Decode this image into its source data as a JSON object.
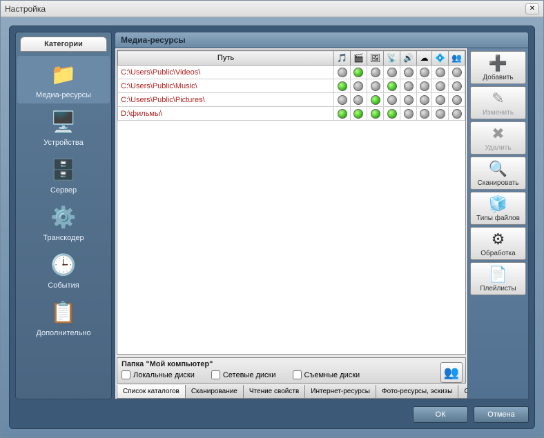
{
  "window": {
    "title": "Настройка"
  },
  "sidebar": {
    "header": "Категории",
    "items": [
      {
        "label": "Медиа-ресурсы",
        "icon": "📁"
      },
      {
        "label": "Устройства",
        "icon": "🖥️"
      },
      {
        "label": "Сервер",
        "icon": "🗄️"
      },
      {
        "label": "Транскодер",
        "icon": "⚙️"
      },
      {
        "label": "События",
        "icon": "🕒"
      },
      {
        "label": "Дополнительно",
        "icon": "📋"
      }
    ]
  },
  "content": {
    "title": "Медиа-ресурсы",
    "columns": {
      "path": "Путь",
      "icons": [
        "🎵",
        "🎬",
        "🖼",
        "📡",
        "🔊",
        "☁",
        "💠",
        "👥"
      ]
    },
    "rows": [
      {
        "path": "C:\\Users\\Public\\Videos\\",
        "flags": [
          0,
          1,
          0,
          0,
          0,
          0,
          0,
          0
        ]
      },
      {
        "path": "C:\\Users\\Public\\Music\\",
        "flags": [
          1,
          0,
          0,
          1,
          0,
          0,
          0,
          0
        ]
      },
      {
        "path": "C:\\Users\\Public\\Pictures\\",
        "flags": [
          0,
          0,
          1,
          0,
          0,
          0,
          0,
          0
        ]
      },
      {
        "path": "D:\\фильмы\\",
        "flags": [
          1,
          1,
          1,
          1,
          0,
          0,
          0,
          0
        ]
      }
    ],
    "folder": {
      "title": "Папка \"Мой компьютер\"",
      "chk1": "Локальные диски",
      "chk2": "Сетевые диски",
      "chk3": "Съемные диски"
    },
    "tabs": [
      "Список каталогов",
      "Сканирование",
      "Чтение свойств",
      "Интернет-ресурсы",
      "Фото-ресурсы, эскизы",
      "Сервис"
    ]
  },
  "actions": [
    {
      "label": "Добавить",
      "icon": "➕",
      "enabled": true
    },
    {
      "label": "Изменить",
      "icon": "✎",
      "enabled": false
    },
    {
      "label": "Удалить",
      "icon": "✖",
      "enabled": false
    },
    {
      "label": "Сканировать",
      "icon": "🔍",
      "enabled": true
    },
    {
      "label": "Типы файлов",
      "icon": "🧊",
      "enabled": true
    },
    {
      "label": "Обработка",
      "icon": "⚙",
      "enabled": true
    },
    {
      "label": "Плейлисты",
      "icon": "📄",
      "enabled": true
    }
  ],
  "buttons": {
    "ok": "ОК",
    "cancel": "Отмена"
  }
}
